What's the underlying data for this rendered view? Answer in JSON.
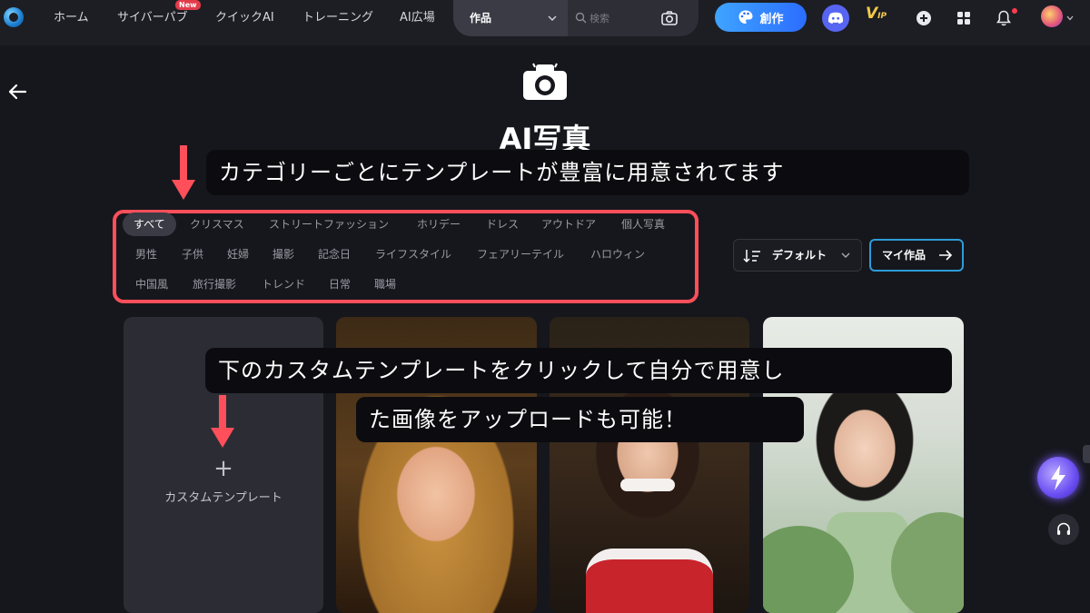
{
  "nav": {
    "items": [
      "ホーム",
      "サイバーパブ",
      "クイックAI",
      "トレーニング",
      "AI広場"
    ],
    "new_badge": "New",
    "search_scope": "作品",
    "search_placeholder": "検索",
    "create_label": "創作",
    "vip_label": "V",
    "vip_suffix": "IP"
  },
  "header": {
    "title": "AI写真"
  },
  "annotations": {
    "top": "カテゴリーごとにテンプレートが豊富に用意されてます",
    "bottom_line1": "下のカスタムテンプレートをクリックして自分で用意し",
    "bottom_line2": "た画像をアップロードも可能！"
  },
  "categories": {
    "row1": [
      "すべて",
      "クリスマス",
      "ストリートファッション",
      "ホリデー",
      "ドレス",
      "アウトドア",
      "個人写真"
    ],
    "row2": [
      "男性",
      "子供",
      "妊婦",
      "撮影",
      "記念日",
      "ライフスタイル",
      "フェアリーテイル",
      "ハロウィン"
    ],
    "row3": [
      "中国風",
      "旅行撮影",
      "トレンド",
      "日常",
      "職場"
    ]
  },
  "controls": {
    "sort_label": "デフォルト",
    "my_works_label": "マイ作品"
  },
  "cards": {
    "custom_plus": "+",
    "custom_label": "カスタムテンプレート"
  },
  "colors": {
    "accent_blue": "#3fa4ff",
    "annotation_red": "#ff4f5a",
    "background": "#16171d"
  }
}
